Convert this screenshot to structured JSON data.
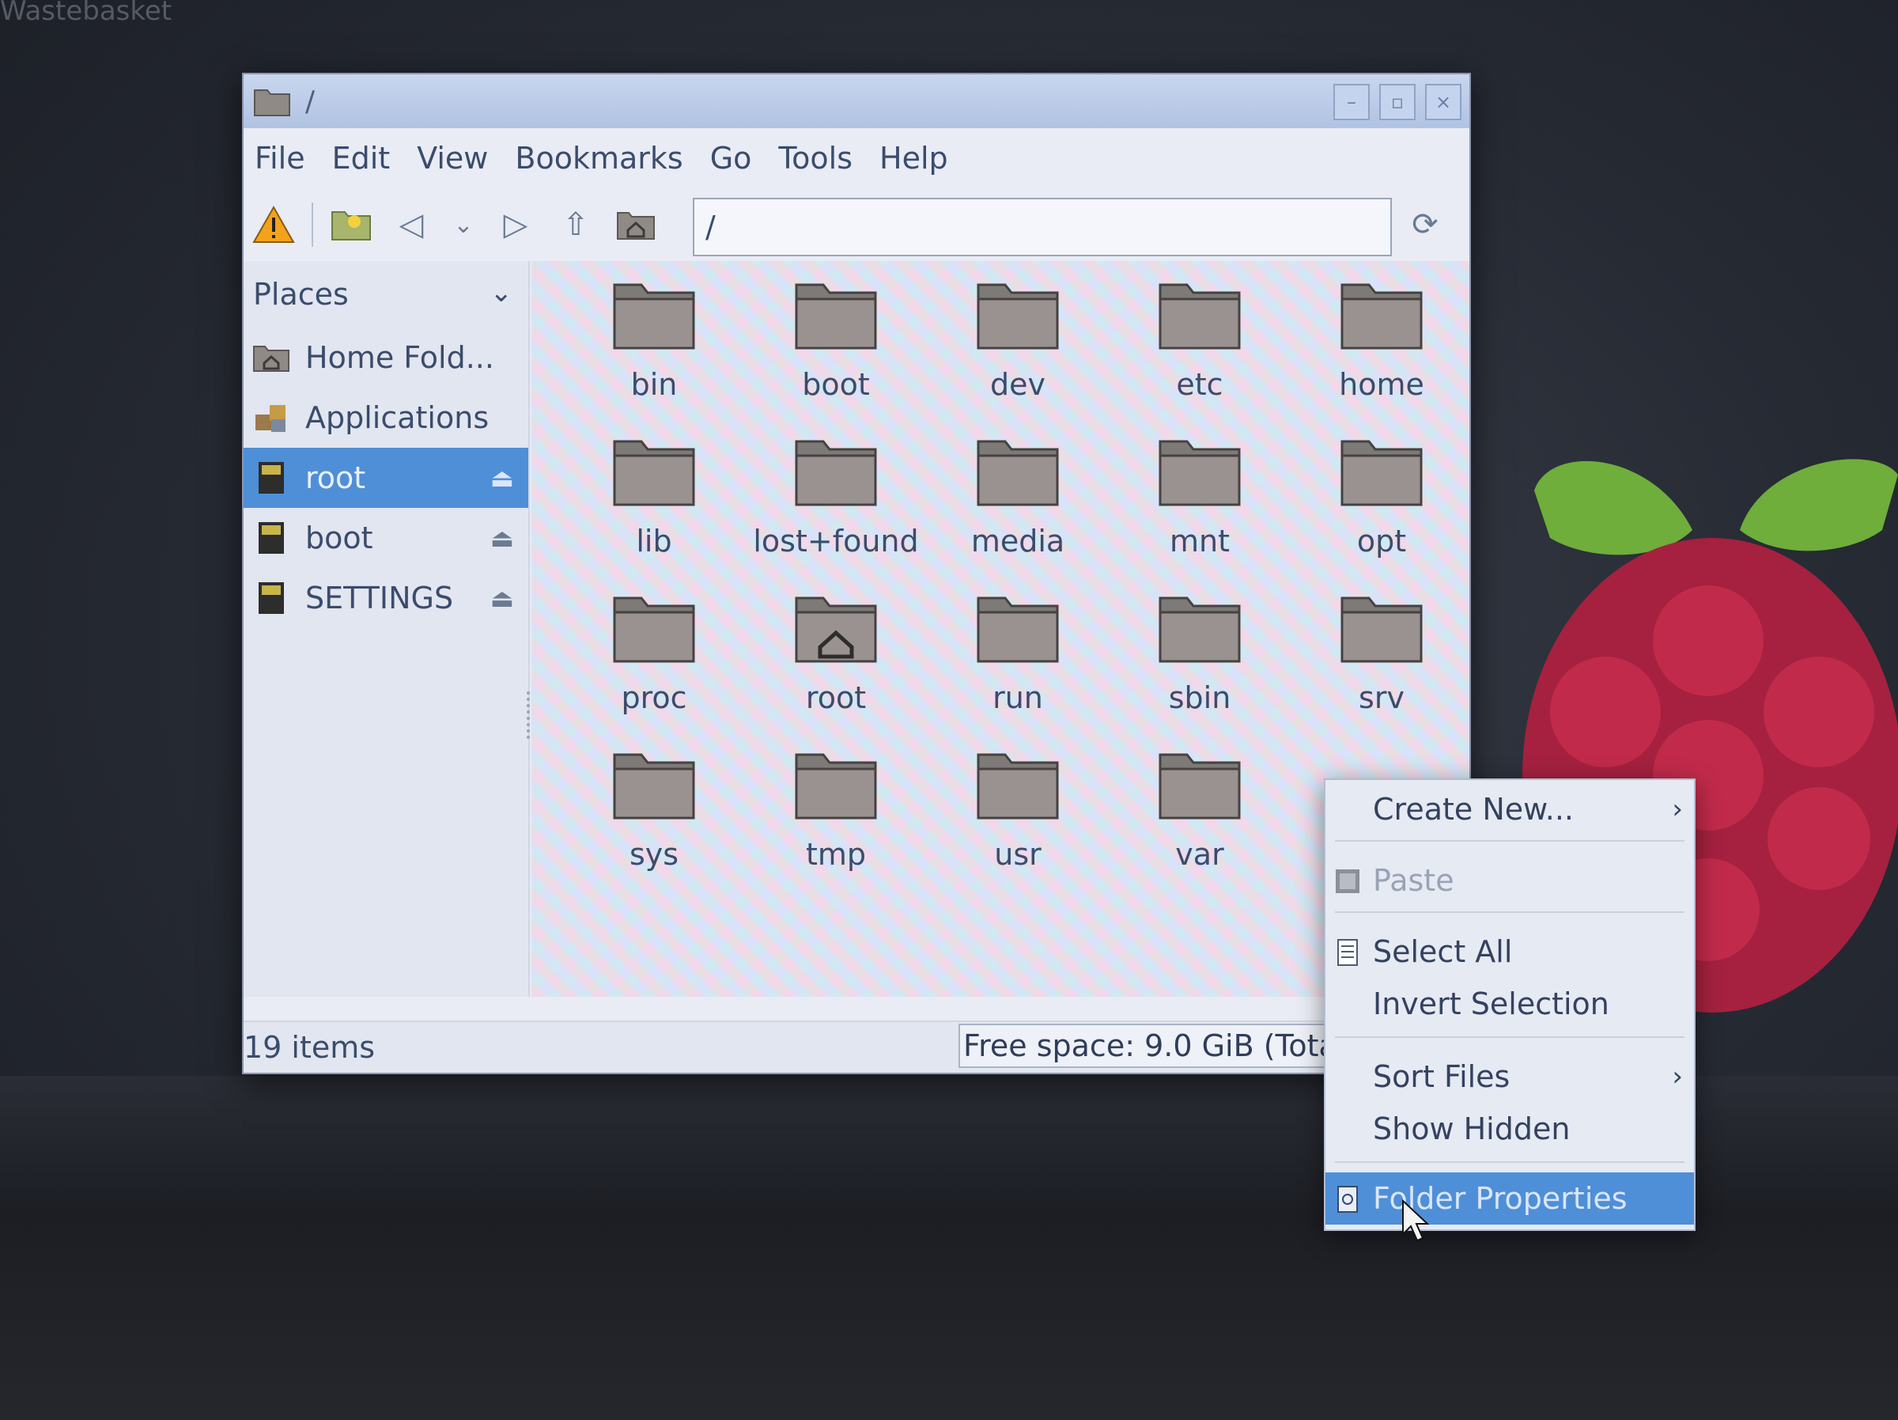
{
  "desktop": {
    "wastebasket_label": "Wastebasket"
  },
  "window": {
    "title": "/",
    "controls": {
      "minimize": "–",
      "maximize": "▫",
      "close": "×"
    }
  },
  "menubar": [
    "File",
    "Edit",
    "View",
    "Bookmarks",
    "Go",
    "Tools",
    "Help"
  ],
  "toolbar": {
    "path_value": "/"
  },
  "sidebar": {
    "header": "Places",
    "items": [
      {
        "label": "Home Fold...",
        "icon": "home-folder-icon"
      },
      {
        "label": "Applications",
        "icon": "applications-icon"
      },
      {
        "label": "root",
        "icon": "drive-icon",
        "selected": true,
        "eject": true
      },
      {
        "label": "boot",
        "icon": "drive-icon",
        "eject": true
      },
      {
        "label": "SETTINGS",
        "icon": "drive-icon",
        "eject": true
      }
    ]
  },
  "files": [
    "bin",
    "boot",
    "dev",
    "etc",
    "home",
    "lib",
    "lost+found",
    "media",
    "mnt",
    "opt",
    "proc",
    "root",
    "run",
    "sbin",
    "srv",
    "sys",
    "tmp",
    "usr",
    "var"
  ],
  "statusbar": {
    "count": "19 items",
    "free_space": "Free space: 9.0 GiB (Total: "
  },
  "context_menu": {
    "create_new": "Create New...",
    "paste": "Paste",
    "select_all": "Select All",
    "invert_selection": "Invert Selection",
    "sort_files": "Sort Files",
    "show_hidden": "Show Hidden",
    "folder_properties": "Folder Properties"
  },
  "colors": {
    "selection": "#4f8fd7",
    "titlebar": "#b1c3e3",
    "text": "#3b4c6c"
  }
}
